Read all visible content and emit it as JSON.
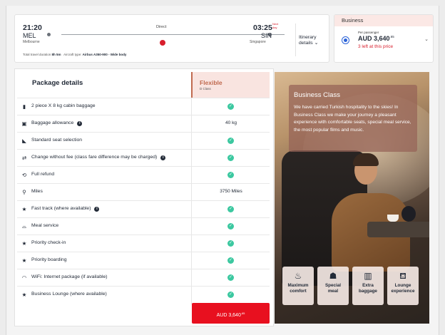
{
  "flight": {
    "depart_time": "21:20",
    "depart_code": "MEL",
    "depart_city": "Melbourne",
    "arrive_time": "03:25",
    "arrive_code": "SIN",
    "arrive_city": "Singapore",
    "next_day": "Next day",
    "stop_label": "Direct",
    "itinerary_label": "Itinerary details",
    "duration_label": "Total travel duration",
    "duration": "8h 5m",
    "aircraft_label": "Aircraft type:",
    "aircraft": "Airbus A350-900 - Wide body"
  },
  "fare": {
    "cabin": "Business",
    "per_passenger": "Per passenger",
    "price": "AUD 3,640",
    "price_cents": ".65",
    "seats_left": "3 left at this price"
  },
  "package": {
    "title": "Package details",
    "fare_name": "Flexible",
    "fare_class": "D Class",
    "rows": [
      {
        "label": "2 piece X 8 kg cabin baggage",
        "icon": "carry-on-bag-icon",
        "value": ""
      },
      {
        "label": "Baggage allowance",
        "icon": "baggage-icon",
        "value": "40 kg"
      },
      {
        "label": "Standard seat selection",
        "icon": "seat-icon",
        "value": ""
      },
      {
        "label": "Change without fee (class fare difference may be charged)",
        "icon": "change-icon",
        "value": ""
      },
      {
        "label": "Full refund",
        "icon": "refund-icon",
        "value": ""
      },
      {
        "label": "Miles",
        "icon": "miles-icon",
        "value": "3750 Miles"
      },
      {
        "label": "Fast track (where available)",
        "icon": "star-icon",
        "value": ""
      },
      {
        "label": "Meal service",
        "icon": "meal-icon",
        "value": ""
      },
      {
        "label": "Priority check-in",
        "icon": "star-icon",
        "value": ""
      },
      {
        "label": "Priority boarding",
        "icon": "star-icon",
        "value": ""
      },
      {
        "label": "WiFi: Internet package (if available)",
        "icon": "wifi-icon",
        "value": ""
      },
      {
        "label": "Business Lounge (where available)",
        "icon": "star-icon",
        "value": ""
      }
    ],
    "select_price": "AUD 3,640",
    "select_price_cents": ".65"
  },
  "business": {
    "title": "Business Class",
    "description": "We have carried Turkish hospitality to the skies! In Business Class we make your journey a pleasant experience with comfortable seats, special meal service, the most popular films and music.",
    "features": [
      {
        "line1": "Maximum",
        "line2": "comfort",
        "icon": "seat-comfort-icon"
      },
      {
        "line1": "Special",
        "line2": "meal",
        "icon": "chef-hat-icon"
      },
      {
        "line1": "Extra",
        "line2": "baggage",
        "icon": "luggage-icon"
      },
      {
        "line1": "Lounge",
        "line2": "experience",
        "icon": "sofa-icon"
      }
    ]
  },
  "colors": {
    "brand_red": "#e8101f",
    "accent_copper": "#c06a4f",
    "check_green": "#3cc8a0",
    "radio_blue": "#2a62d8"
  }
}
